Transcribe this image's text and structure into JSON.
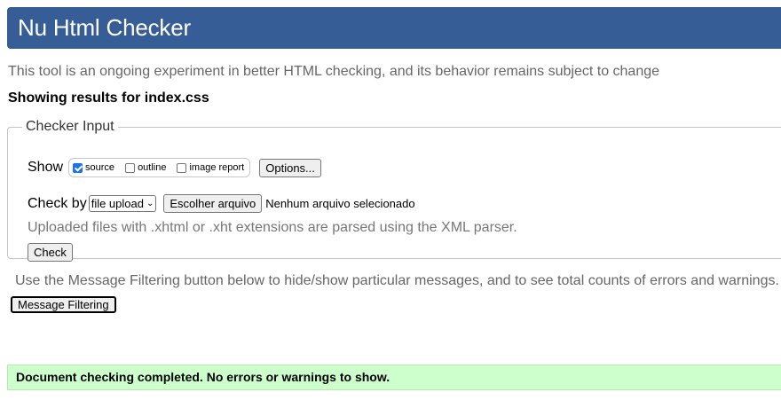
{
  "header": {
    "title": "Nu Html Checker"
  },
  "intro": "This tool is an ongoing experiment in better HTML checking, and its behavior remains subject to change",
  "showing": "Showing results for index.css",
  "checker": {
    "legend": "Checker Input",
    "show_label": "Show",
    "options": [
      {
        "label": "source",
        "checked": true
      },
      {
        "label": "outline",
        "checked": false
      },
      {
        "label": "image report",
        "checked": false
      }
    ],
    "options_button": "Options...",
    "check_by_label": "Check by",
    "check_by_selected": "file upload",
    "file_button": "Escolher arquivo",
    "file_status": "Nenhum arquivo selecionado",
    "xml_note": "Uploaded files with .xhtml or .xht extensions are parsed using the XML parser.",
    "check_button": "Check"
  },
  "filter_note": "Use the Message Filtering button below to hide/show particular messages, and to see total counts of errors and warnings.",
  "filter_button": "Message Filtering",
  "result": "Document checking completed. No errors or warnings to show.",
  "colors": {
    "header_bg": "#365d95",
    "success_bg": "#ccffcc"
  }
}
